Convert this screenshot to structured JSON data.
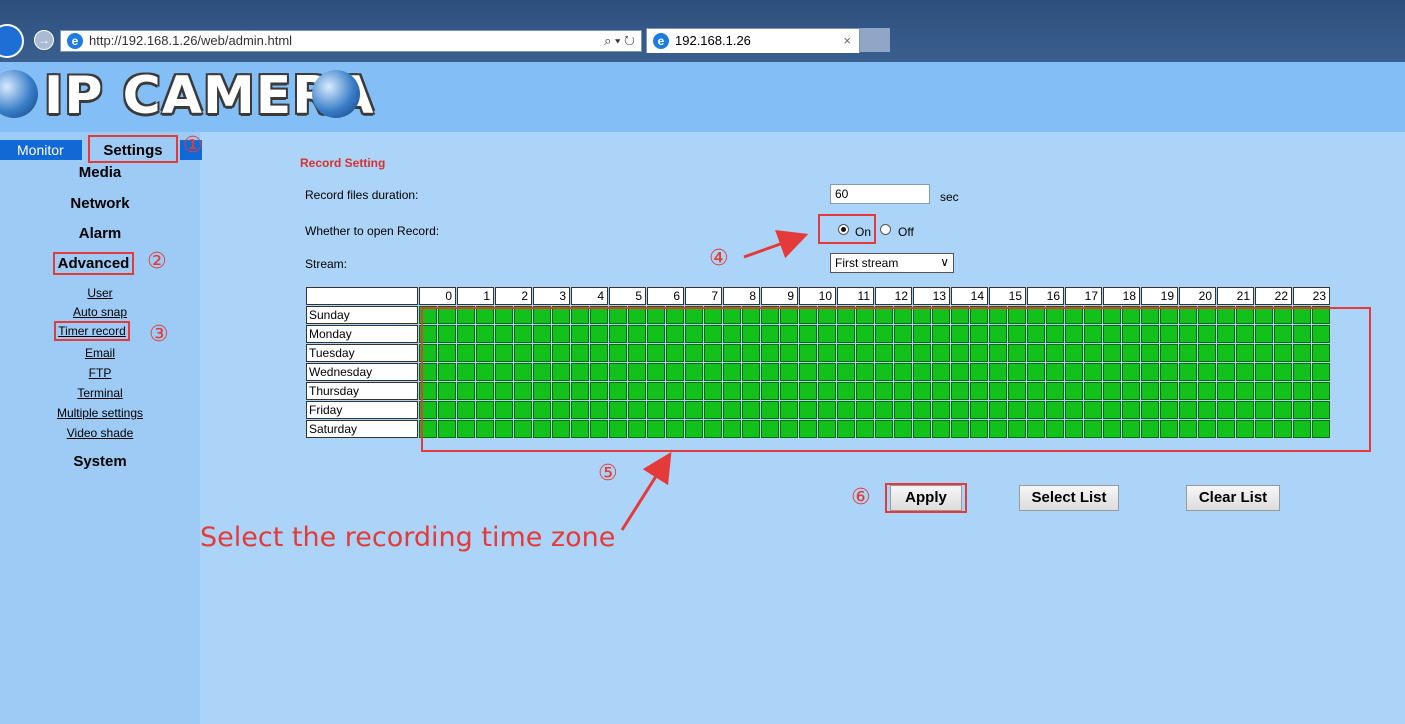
{
  "browser": {
    "url": "http://192.168.1.26/web/admin.html",
    "url_controls": "⌕ ▾ ↻",
    "tab_title": "192.168.1.26",
    "tab_close": "×",
    "forward": "→"
  },
  "banner": {
    "title": "IP CAMERA"
  },
  "nav": {
    "monitor": "Monitor",
    "settings": "Settings"
  },
  "menu": {
    "heads": [
      "Media",
      "Network",
      "Alarm",
      "Advanced",
      "System"
    ],
    "advanced_items": [
      "User",
      "Auto snap",
      "Timer record",
      "Email",
      "FTP",
      "Terminal",
      "Multiple settings",
      "Video shade"
    ]
  },
  "form": {
    "section_title": "Record Setting",
    "duration_label": "Record files duration:",
    "duration_value": "60",
    "duration_unit": "sec",
    "open_record_label": "Whether to open Record:",
    "on_label": "On",
    "off_label": "Off",
    "stream_label": "Stream:",
    "stream_value": "First stream"
  },
  "schedule": {
    "hours": [
      "0",
      "1",
      "2",
      "3",
      "4",
      "5",
      "6",
      "7",
      "8",
      "9",
      "10",
      "11",
      "12",
      "13",
      "14",
      "15",
      "16",
      "17",
      "18",
      "19",
      "20",
      "21",
      "22",
      "23"
    ],
    "days": [
      "Sunday",
      "Monday",
      "Tuesday",
      "Wednesday",
      "Thursday",
      "Friday",
      "Saturday"
    ],
    "all_selected": true
  },
  "buttons": {
    "apply": "Apply",
    "select_list": "Select List",
    "clear_list": "Clear List"
  },
  "markers": [
    "①",
    "②",
    "③",
    "④",
    "⑤",
    "⑥"
  ],
  "annotation": "Select the recording time zone",
  "colors": {
    "accent_red": "#e53a3a",
    "slot_green": "#12c21a",
    "nav_blue": "#1169d6"
  }
}
